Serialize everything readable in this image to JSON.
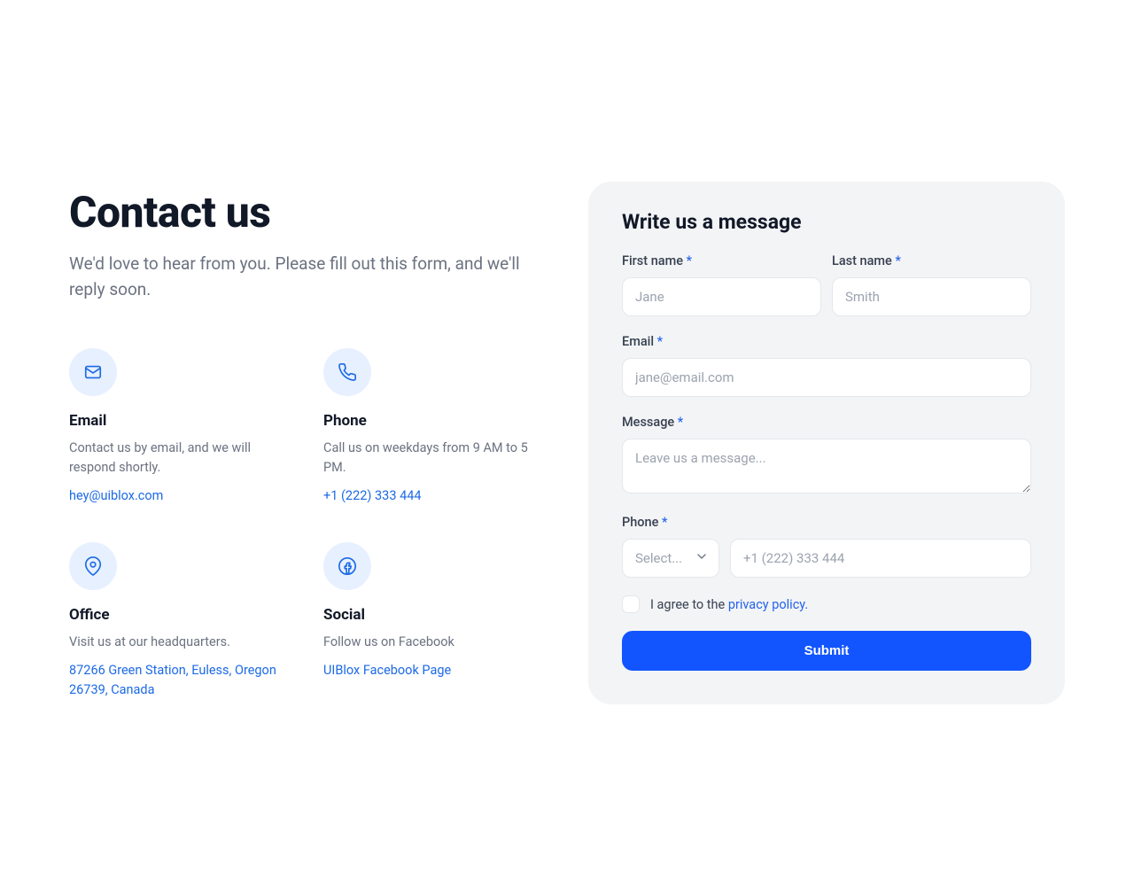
{
  "header": {
    "title": "Contact us",
    "subtitle": "We'd love to hear from you. Please fill out this form, and we'll reply soon."
  },
  "info": {
    "email": {
      "title": "Email",
      "desc": "Contact us by email, and we will respond shortly.",
      "link": "hey@uiblox.com"
    },
    "phone": {
      "title": "Phone",
      "desc": "Call us on weekdays from 9 AM to 5 PM.",
      "link": "+1 (222) 333 444"
    },
    "office": {
      "title": "Office",
      "desc": "Visit us at our headquarters.",
      "link": "87266 Green Station, Euless, Oregon 26739, Canada"
    },
    "social": {
      "title": "Social",
      "desc": "Follow us on Facebook",
      "link": "UIBlox Facebook Page"
    }
  },
  "form": {
    "title": "Write us a message",
    "first_name": {
      "label": "First name",
      "placeholder": "Jane"
    },
    "last_name": {
      "label": "Last name",
      "placeholder": "Smith"
    },
    "email": {
      "label": "Email",
      "placeholder": "jane@email.com"
    },
    "message": {
      "label": "Message",
      "placeholder": "Leave us a message..."
    },
    "phone": {
      "label": "Phone",
      "select_placeholder": "Select...",
      "placeholder": "+1 (222) 333 444"
    },
    "agree_prefix": "I agree to the ",
    "agree_link": "privacy policy.",
    "submit_label": "Submit"
  }
}
